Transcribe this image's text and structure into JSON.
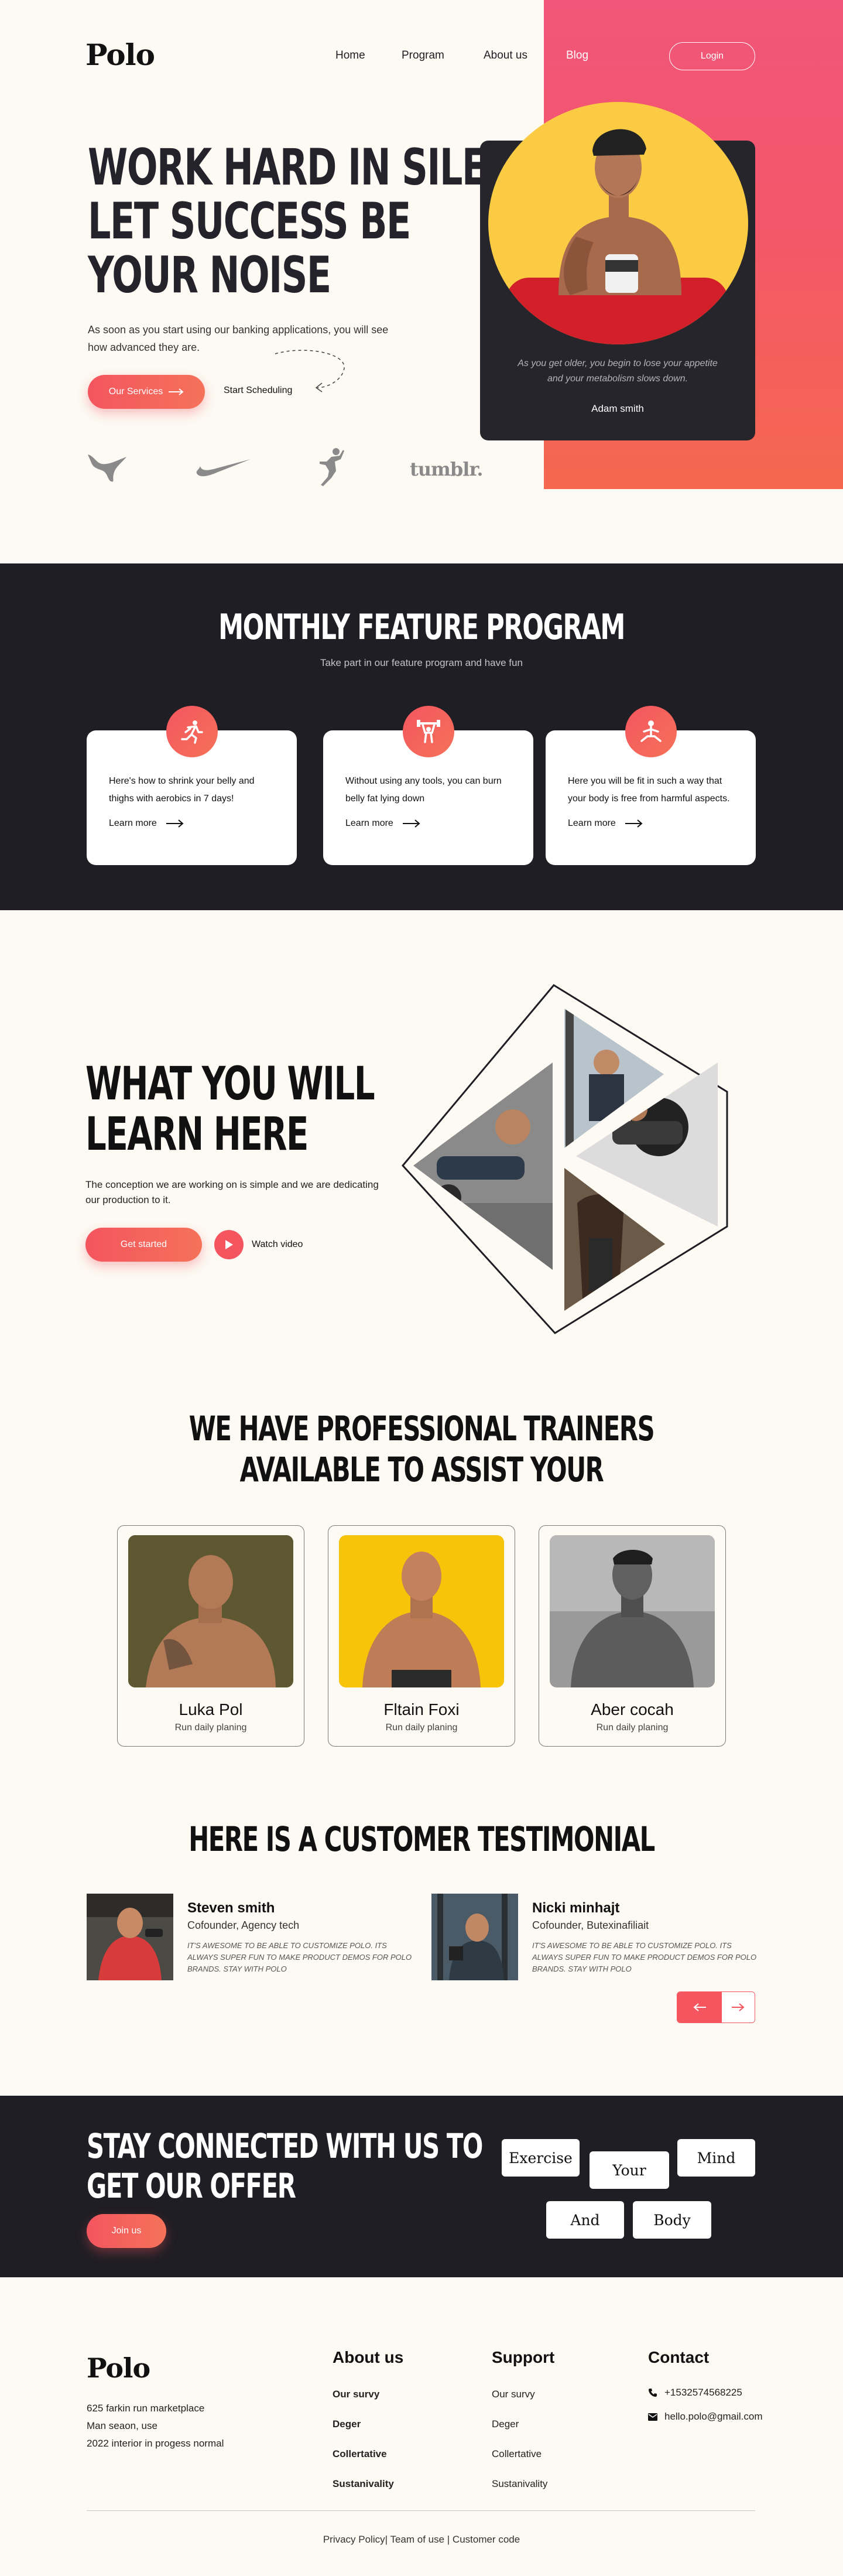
{
  "header": {
    "logo": "Polo",
    "nav": [
      "Home",
      "Program",
      "About us",
      "Blog"
    ],
    "login": "Login"
  },
  "hero": {
    "title_lines": [
      "WORK HARD IN SILENCE",
      "LET SUCCESS BE",
      "YOUR NOISE"
    ],
    "text": "As soon as you start using our banking applications, you will see how advanced they are.",
    "services_btn": "Our Services",
    "schedule_link": "Start Scheduling",
    "quote": "As you get older, you begin to lose your appetite and your metabolism slows down.",
    "quote_author": "Adam smith",
    "brands": [
      "puma-logo",
      "nike-logo",
      "jumpman-logo",
      "tumblr."
    ]
  },
  "program": {
    "title": "MONTHLY FEATURE PROGRAM",
    "subtitle": "Take part in our feature program and have fun",
    "cards": [
      {
        "icon": "running-icon",
        "text": "Here's how to shrink your belly and thighs with aerobics in 7 days!",
        "link": "Learn more"
      },
      {
        "icon": "weightlifting-icon",
        "text": "Without using any tools, you can burn belly fat lying down",
        "link": "Learn more"
      },
      {
        "icon": "meditation-icon",
        "text": "Here you will be fit in such a way that your body is free from harmful aspects.",
        "link": "Learn more"
      }
    ]
  },
  "learn": {
    "title_lines": [
      "WHAT YOU WILL",
      "LEARN HERE"
    ],
    "text": "The conception we are working on is simple and we are dedicating our production to it.",
    "start_btn": "Get started",
    "video_link": "Watch video"
  },
  "trainers": {
    "title_lines": [
      "WE HAVE PROFESSIONAL TRAINERS",
      "AVAILABLE TO ASSIST YOUR"
    ],
    "items": [
      {
        "name": "Luka Pol",
        "role": "Run daily planing"
      },
      {
        "name": "Fltain Foxi",
        "role": "Run daily planing"
      },
      {
        "name": "Aber cocah",
        "role": "Run daily planing"
      }
    ]
  },
  "testimonials": {
    "title": "HERE IS A CUSTOMER TESTIMONIAL",
    "items": [
      {
        "name": "Steven smith",
        "role": "Cofounder, Agency tech",
        "text": "It's awesome to be able to customize polo. Its always super fun to make product demos for polo brands. stay with polo"
      },
      {
        "name": "Nicki minhajt",
        "role": "Cofounder, Butexinafiliait",
        "text": "It's awesome to be able to customize polo. Its always super fun to make product demos for polo brands. stay with polo"
      }
    ]
  },
  "cta": {
    "title_lines": [
      "STAY CONNECTED WITH US TO",
      "GET OUR OFFER"
    ],
    "join_btn": "Join us",
    "words": [
      "Exercise",
      "Your",
      "Mind",
      "And",
      "Body"
    ]
  },
  "footer": {
    "logo": "Polo",
    "address": [
      "625 farkin run marketplace",
      "Man seaon, use",
      "2022 interior in progess normal"
    ],
    "about_title": "About us",
    "about_links": [
      "Our survy",
      "Deger",
      "Collertative",
      "Sustanivality"
    ],
    "support_title": "Support",
    "support_links": [
      "Our survy",
      "Deger",
      "Collertative",
      "Sustanivality"
    ],
    "contact_title": "Contact",
    "phone": "+1532574568225",
    "email": "hello.polo@gmail.com",
    "bottom": "Privacy Policy| Team of use | Customer code"
  },
  "colors": {
    "accent": "#f4555f",
    "dark": "#1f1e24",
    "cream": "#fdf9f3",
    "yellow": "#fbcb44"
  }
}
